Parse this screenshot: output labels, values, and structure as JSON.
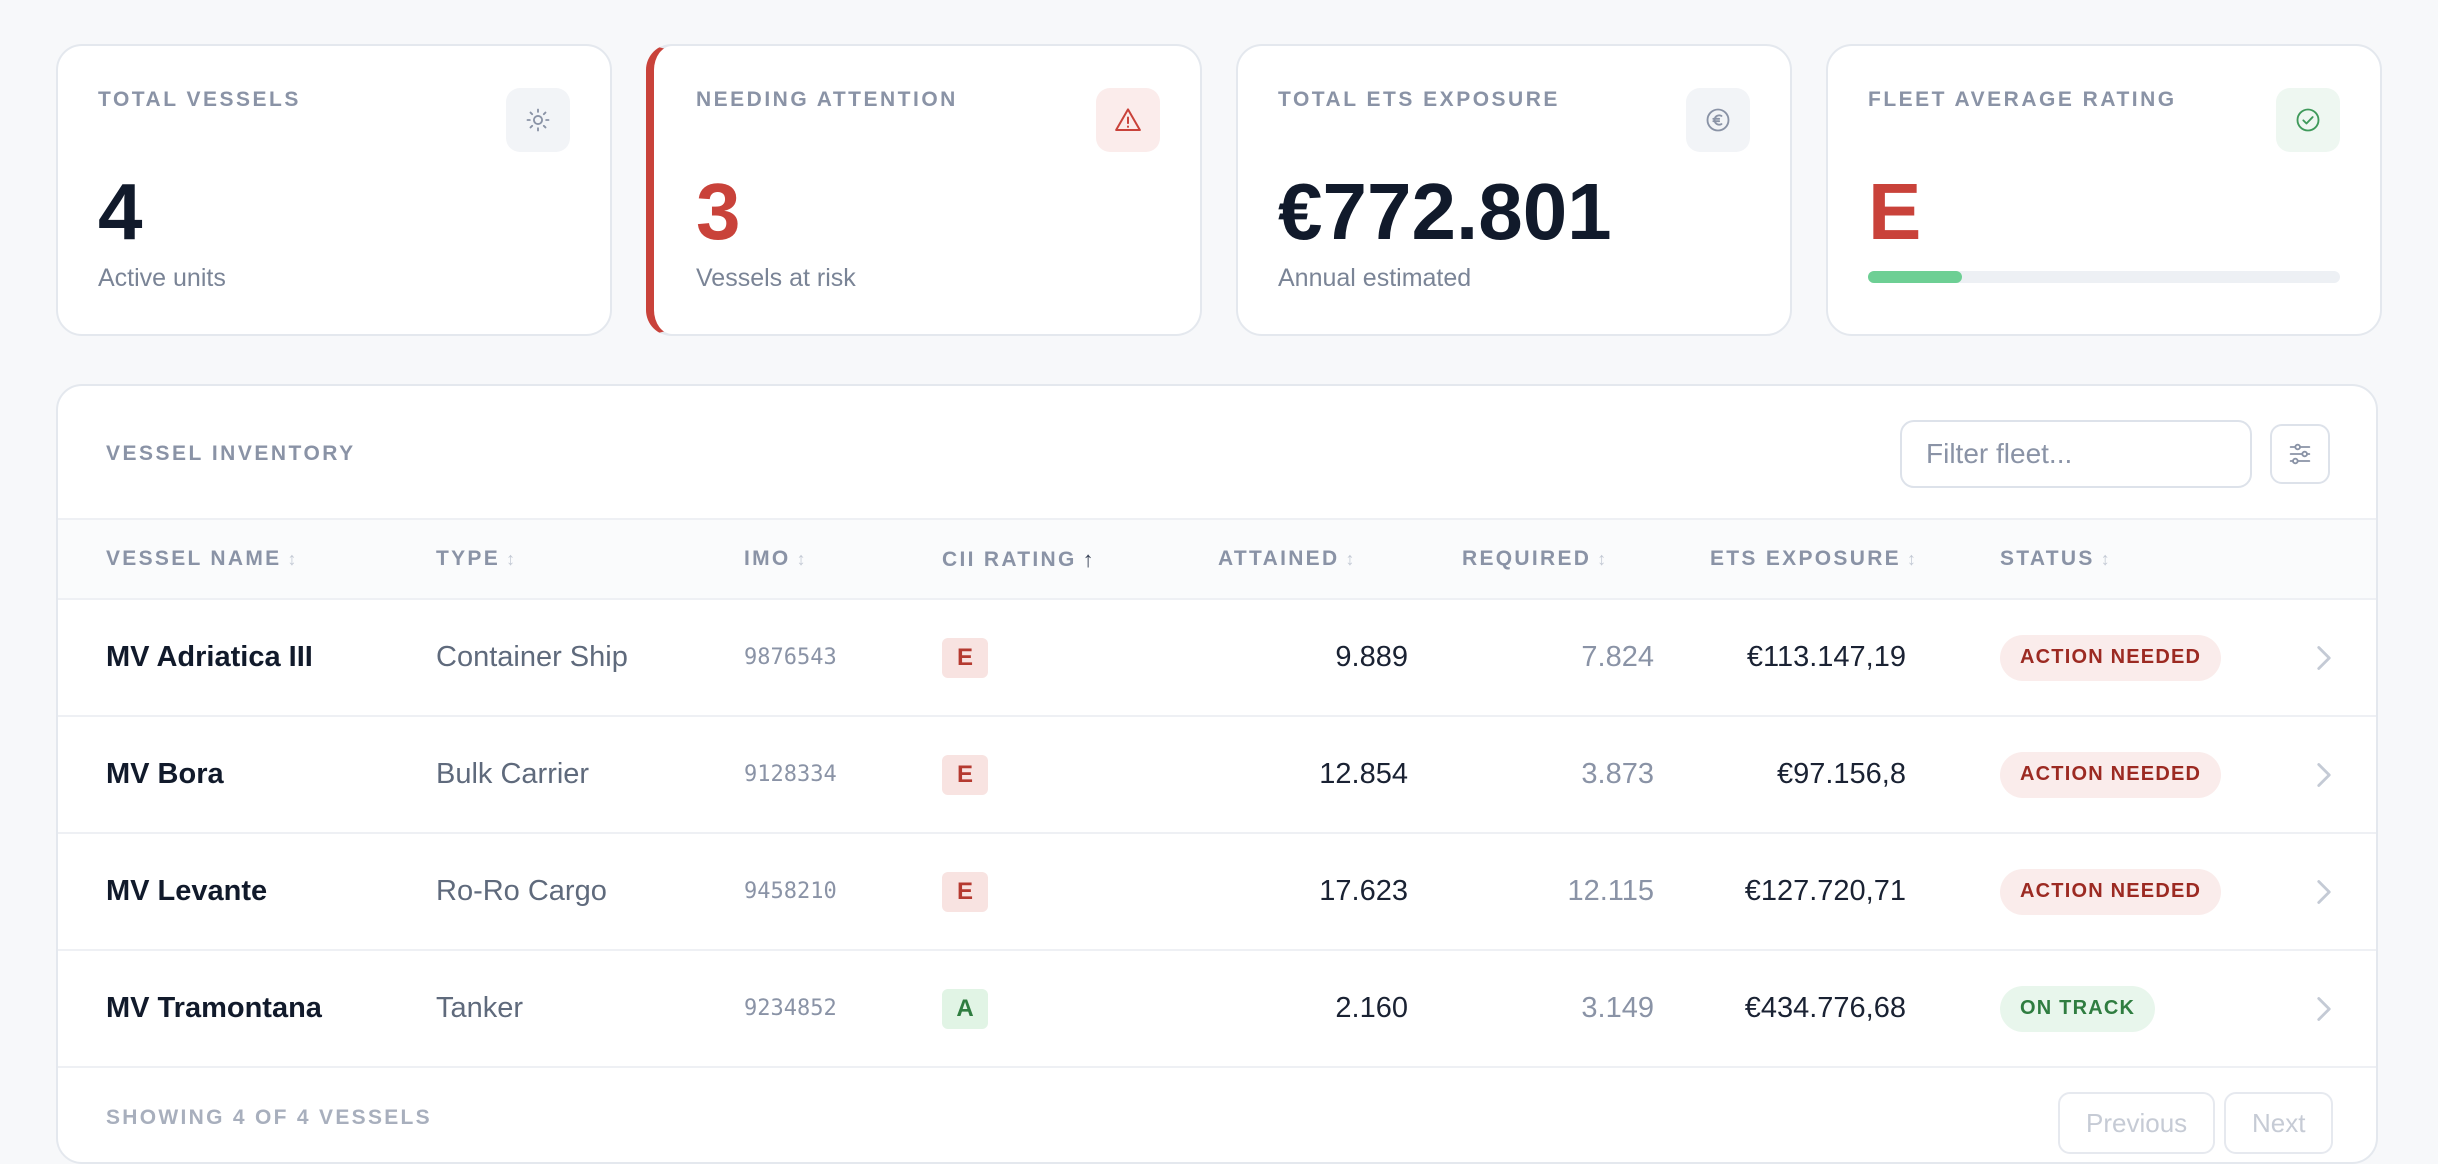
{
  "kpis": {
    "total_vessels": {
      "label": "TOTAL VESSELS",
      "value": "4",
      "sub": "Active units",
      "icon": "sun-icon"
    },
    "needing_attention": {
      "label": "NEEDING ATTENTION",
      "value": "3",
      "sub": "Vessels at risk",
      "icon": "warning-icon"
    },
    "ets_exposure": {
      "label": "TOTAL ETS EXPOSURE",
      "value": "€772.801",
      "sub": "Annual estimated",
      "icon": "euro-icon"
    },
    "fleet_rating": {
      "label": "FLEET AVERAGE RATING",
      "value": "E",
      "icon": "check-circle-icon",
      "progress_fraction": 0.2
    }
  },
  "inventory": {
    "title": "VESSEL INVENTORY",
    "filter_placeholder": "Filter fleet...",
    "columns": {
      "name": "VESSEL NAME",
      "type": "TYPE",
      "imo": "IMO",
      "cii": "CII RATING",
      "attained": "ATTAINED",
      "required": "REQUIRED",
      "ets": "ETS EXPOSURE",
      "status": "STATUS"
    },
    "sorted_by": "cii",
    "sort_direction": "ascending",
    "rows": [
      {
        "name": "MV Adriatica III",
        "type": "Container Ship",
        "imo": "9876543",
        "cii": "E",
        "attained": "9.889",
        "required": "7.824",
        "ets": "€113.147,19",
        "status": "ACTION NEEDED",
        "status_kind": "bad"
      },
      {
        "name": "MV Bora",
        "type": "Bulk Carrier",
        "imo": "9128334",
        "cii": "E",
        "attained": "12.854",
        "required": "3.873",
        "ets": "€97.156,8",
        "status": "ACTION NEEDED",
        "status_kind": "bad"
      },
      {
        "name": "MV Levante",
        "type": "Ro-Ro Cargo",
        "imo": "9458210",
        "cii": "E",
        "attained": "17.623",
        "required": "12.115",
        "ets": "€127.720,71",
        "status": "ACTION NEEDED",
        "status_kind": "bad"
      },
      {
        "name": "MV Tramontana",
        "type": "Tanker",
        "imo": "9234852",
        "cii": "A",
        "attained": "2.160",
        "required": "3.149",
        "ets": "€434.776,68",
        "status": "ON TRACK",
        "status_kind": "good"
      }
    ],
    "footer_text": "SHOWING 4 OF 4 VESSELS",
    "prev_label": "Previous",
    "next_label": "Next"
  },
  "colors": {
    "danger": "#c9423a",
    "success": "#6dcf94",
    "muted": "#8a93a6"
  }
}
